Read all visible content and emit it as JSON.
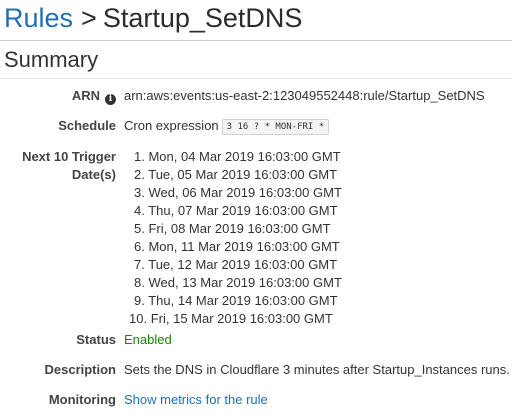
{
  "header": {
    "breadcrumb_link": "Rules",
    "separator": ">",
    "title": "Startup_SetDNS"
  },
  "summary": {
    "title": "Summary",
    "arn": {
      "label": "ARN",
      "icon": "info-icon",
      "value": "arn:aws:events:us-east-2:123049552448:rule/Startup_SetDNS"
    },
    "schedule": {
      "label": "Schedule",
      "type": "Cron expression",
      "expression": "3 16 ? * MON-FRI *"
    },
    "trigger_dates": {
      "label_line1": "Next 10 Trigger",
      "label_line2": "Date(s)",
      "items": [
        {
          "num": "1.",
          "date": "Mon, 04 Mar 2019 16:03:00 GMT"
        },
        {
          "num": "2.",
          "date": "Tue, 05 Mar 2019 16:03:00 GMT"
        },
        {
          "num": "3.",
          "date": "Wed, 06 Mar 2019 16:03:00 GMT"
        },
        {
          "num": "4.",
          "date": "Thu, 07 Mar 2019 16:03:00 GMT"
        },
        {
          "num": "5.",
          "date": "Fri, 08 Mar 2019 16:03:00 GMT"
        },
        {
          "num": "6.",
          "date": "Mon, 11 Mar 2019 16:03:00 GMT"
        },
        {
          "num": "7.",
          "date": "Tue, 12 Mar 2019 16:03:00 GMT"
        },
        {
          "num": "8.",
          "date": "Wed, 13 Mar 2019 16:03:00 GMT"
        },
        {
          "num": "9.",
          "date": "Thu, 14 Mar 2019 16:03:00 GMT"
        },
        {
          "num": "10.",
          "date": "Fri, 15 Mar 2019 16:03:00 GMT"
        }
      ]
    },
    "status": {
      "label": "Status",
      "value": "Enabled",
      "color": "#1d8102"
    },
    "description": {
      "label": "Description",
      "value": "Sets the DNS in Cloudflare 3 minutes after Startup_Instances runs."
    },
    "monitoring": {
      "label": "Monitoring",
      "link": "Show metrics for the rule"
    }
  },
  "colors": {
    "link": "#1f6fb5",
    "text": "#333333",
    "enabled": "#1d8102"
  }
}
